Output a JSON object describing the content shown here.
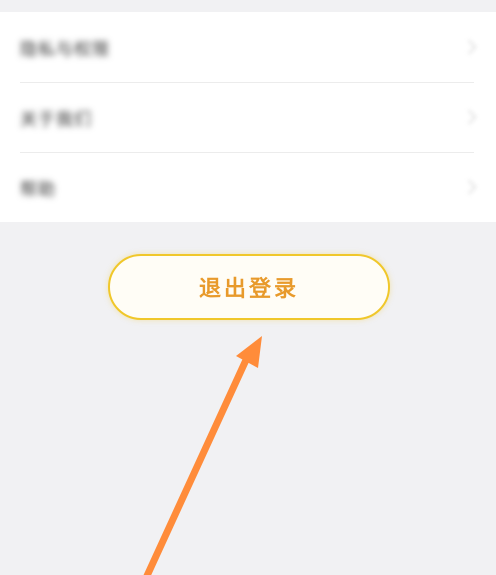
{
  "settings": {
    "rows": [
      {
        "label": "隐私与权限"
      },
      {
        "label": "关于我们"
      },
      {
        "label": "帮助"
      }
    ]
  },
  "logout": {
    "label": "退出登录"
  },
  "colors": {
    "page_background": "#f1f1f3",
    "list_background": "#ffffff",
    "button_border": "#f0c72a",
    "button_text": "#e89a2b",
    "annotation_arrow": "#ff8c3a"
  },
  "icons": {
    "row_chevron": "chevron-right-icon",
    "annotation": "arrow-up-annotation-icon"
  }
}
